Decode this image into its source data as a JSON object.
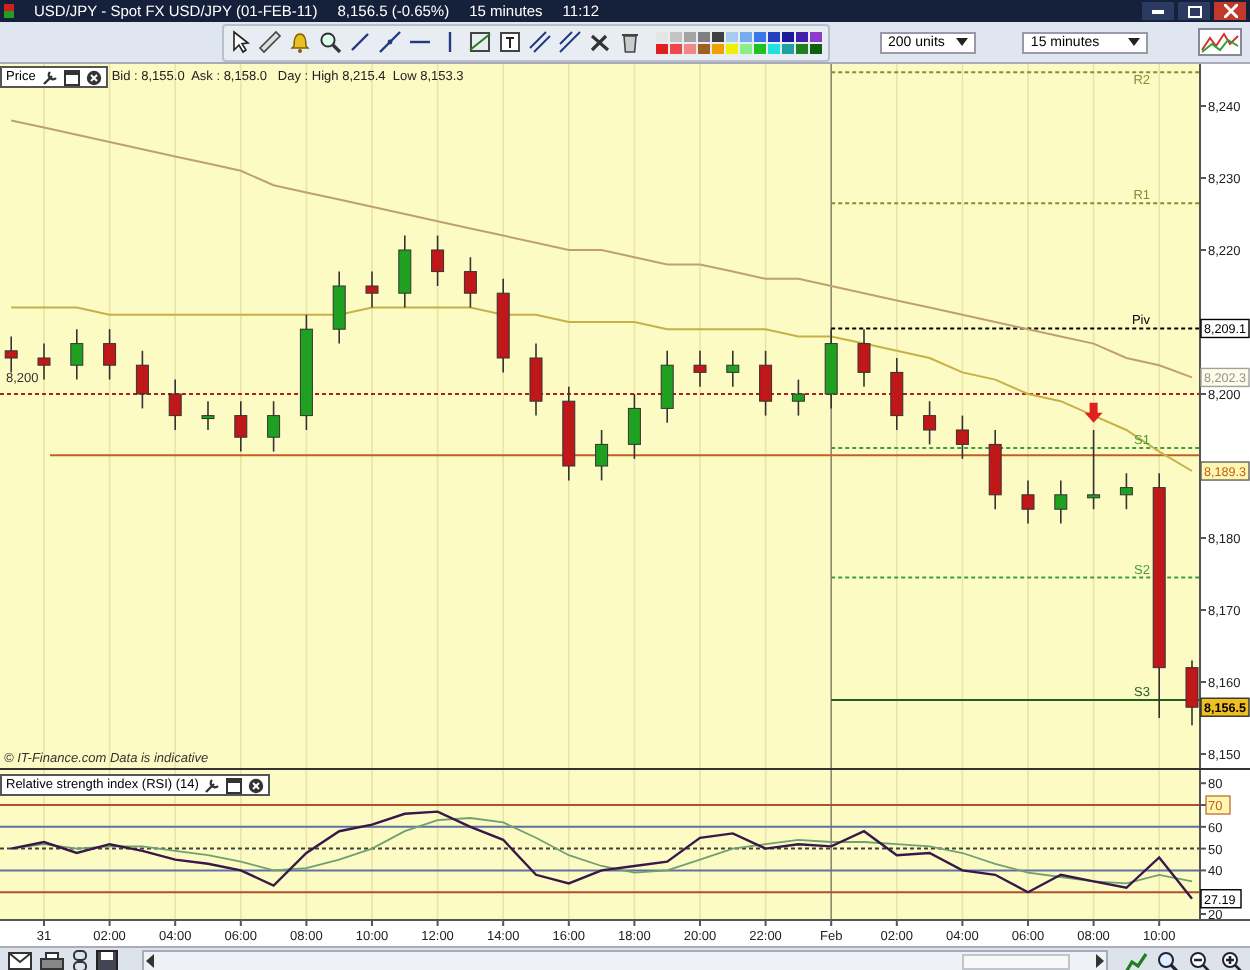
{
  "window": {
    "title": "USD/JPY - Spot FX USD/JPY (01-FEB-11)",
    "price": "8,156.5 (-0.65%)",
    "interval": "15 minutes",
    "time": "11:12"
  },
  "toolbar": {
    "palette": [
      {
        "color": "#e4e4e4"
      },
      {
        "color": "#c4c4c4"
      },
      {
        "color": "#a4a4a4"
      },
      {
        "color": "#808080"
      },
      {
        "color": "#404040"
      },
      {
        "color": "#a8ccf0"
      },
      {
        "color": "#78acf0"
      },
      {
        "color": "#3c78e8"
      },
      {
        "color": "#2040c0"
      },
      {
        "color": "#18189c"
      },
      {
        "color": "#4020a8"
      },
      {
        "color": "#8c3cc8"
      },
      {
        "color": "#e02020"
      },
      {
        "color": "#f04848"
      },
      {
        "color": "#f08888"
      },
      {
        "color": "#a06020"
      },
      {
        "color": "#f0a000"
      },
      {
        "color": "#f0f000"
      },
      {
        "color": "#88f088"
      },
      {
        "color": "#20c020"
      },
      {
        "color": "#20e0e0"
      },
      {
        "color": "#20a0a0"
      },
      {
        "color": "#208020"
      },
      {
        "color": "#106010"
      }
    ],
    "units_select": "200 units",
    "interval_select": "15 minutes"
  },
  "price_chart": {
    "label": "Price",
    "quote": "Bid : 8,155.0  Ask : 8,158.0   Day : High 8,215.4  Low 8,153.3",
    "footer": "© IT-Finance.com  Data is indicative",
    "chart_data": {
      "type": "candlestick",
      "grid": true,
      "ylim": [
        8148.06,
        8245.83
      ],
      "categories": [
        null,
        null,
        null,
        null,
        null,
        null,
        null,
        null,
        null,
        null,
        null,
        null,
        null,
        null,
        null,
        null,
        null,
        null,
        null,
        null,
        null,
        null,
        null,
        null,
        null,
        null,
        null,
        null,
        null,
        null,
        null,
        null,
        null,
        null,
        null,
        null,
        null
      ],
      "yticks": [
        {
          "value": 8240,
          "label": "8,240"
        },
        {
          "value": 8230,
          "label": "8,230"
        },
        {
          "value": 8220,
          "label": "8,220"
        },
        {
          "value": 8200,
          "label": "8,200"
        },
        {
          "value": 8180,
          "label": "8,180"
        },
        {
          "value": 8170,
          "label": "8,170"
        },
        {
          "value": 8160,
          "label": "8,160"
        },
        {
          "value": 8150,
          "label": "8,150"
        }
      ],
      "ohlc": [
        [
          8206,
          8208,
          8203,
          8205
        ],
        [
          8205,
          8207,
          8202,
          8204
        ],
        [
          8204,
          8209,
          8202,
          8207
        ],
        [
          8207,
          8209,
          8202,
          8204
        ],
        [
          8204,
          8206,
          8198,
          8200
        ],
        [
          8200,
          8202,
          8195,
          8197
        ],
        [
          8197,
          8199,
          8195,
          8197
        ],
        [
          8197,
          8199,
          8192,
          8194
        ],
        [
          8194,
          8199,
          8192,
          8197
        ],
        [
          8197,
          8211,
          8195,
          8209
        ],
        [
          8209,
          8217,
          8207,
          8215
        ],
        [
          8215,
          8217,
          8212,
          8214
        ],
        [
          8214,
          8222,
          8212,
          8220
        ],
        [
          8220,
          8222,
          8215,
          8217
        ],
        [
          8217,
          8219,
          8212,
          8214
        ],
        [
          8214,
          8216,
          8203,
          8205
        ],
        [
          8205,
          8207,
          8197,
          8199
        ],
        [
          8199,
          8201,
          8188,
          8190
        ],
        [
          8190,
          8195,
          8188,
          8193
        ],
        [
          8193,
          8200,
          8191,
          8198
        ],
        [
          8198,
          8206,
          8196,
          8204
        ],
        [
          8204,
          8206,
          8201,
          8203
        ],
        [
          8203,
          8206,
          8201,
          8204
        ],
        [
          8204,
          8206,
          8197,
          8199
        ],
        [
          8199,
          8202,
          8197,
          8200
        ],
        [
          8200,
          8209,
          8198,
          8207
        ],
        [
          8207,
          8209,
          8201,
          8203
        ],
        [
          8203,
          8205,
          8195,
          8197
        ],
        [
          8197,
          8199,
          8193,
          8195
        ],
        [
          8195,
          8197,
          8191,
          8193
        ],
        [
          8193,
          8195,
          8184,
          8186
        ],
        [
          8186,
          8188,
          8182,
          8184
        ],
        [
          8184,
          8188,
          8182,
          8186
        ],
        [
          8186,
          8195,
          8184,
          8186
        ],
        [
          8186,
          8189,
          8184,
          8187
        ],
        [
          8187,
          8189,
          8155,
          8162
        ],
        [
          8162,
          8163,
          8154,
          8156.5
        ]
      ],
      "series": [
        {
          "type": "line",
          "color": "#c0a070",
          "values": [
            8238,
            8237,
            8236,
            8235,
            8234,
            8233,
            8232,
            8231,
            8229,
            8228,
            8227,
            8226,
            8225,
            8224,
            8223,
            8222,
            8221,
            8220,
            8220,
            8219,
            8218,
            8218,
            8217,
            8216,
            8216,
            8215,
            8214,
            8213,
            8212,
            8211,
            8210,
            8209,
            8208,
            8207,
            8205,
            8204,
            8202.3
          ]
        },
        {
          "type": "line",
          "color": "#c8b048",
          "values": [
            8212,
            8212,
            8212,
            8211,
            8211,
            8211,
            8211,
            8211,
            8211,
            8211,
            8211,
            8212,
            8212,
            8212,
            8212,
            8211,
            8211,
            8210,
            8210,
            8210,
            8209,
            8209,
            8209,
            8209,
            8208,
            8208,
            8207,
            8206,
            8205,
            8203,
            8202,
            8200,
            8199,
            8197,
            8195,
            8192,
            8189.3
          ]
        }
      ],
      "ref_lines": [
        {
          "axis": "y",
          "value": 8244.7,
          "label": "R2"
        },
        {
          "axis": "y",
          "value": 8226.5,
          "label": "R1"
        },
        {
          "axis": "y",
          "value": 8209.1,
          "label": "Piv"
        },
        {
          "axis": "y",
          "value": 8200,
          "label": "8,200"
        },
        {
          "axis": "y",
          "value": 8191.5
        },
        {
          "axis": "y",
          "value": 8192.5,
          "label": "S1"
        },
        {
          "axis": "y",
          "value": 8174.5,
          "label": "S2"
        },
        {
          "axis": "y",
          "value": 8157.5,
          "label": "S3"
        }
      ],
      "annotations": [
        "8,209.1",
        "8,202.3",
        "8,189.3",
        "8,156.5"
      ]
    }
  },
  "rsi_panel": {
    "label": "Relative strength index (RSI) (14)",
    "chart_data": {
      "type": "line",
      "grid": true,
      "ylim": [
        17.25,
        86.06
      ],
      "categories": [
        null,
        "31",
        null,
        "02:00",
        null,
        "04:00",
        null,
        "06:00",
        null,
        "08:00",
        null,
        "10:00",
        null,
        "12:00",
        null,
        "14:00",
        null,
        "16:00",
        null,
        "18:00",
        null,
        "20:00",
        null,
        "22:00",
        null,
        "Feb",
        null,
        "02:00",
        null,
        "04:00",
        null,
        "06:00",
        null,
        "08:00",
        null,
        "10:00",
        null
      ],
      "yticks": [
        {
          "value": 80,
          "label": "80"
        },
        {
          "value": 70,
          "label": "70"
        },
        {
          "value": 60,
          "label": "60"
        },
        {
          "value": 50,
          "label": "50"
        },
        {
          "value": 40,
          "label": "40"
        },
        {
          "value": 20,
          "label": "20"
        }
      ],
      "series": [
        {
          "color": "#381848",
          "values": [
            50,
            53,
            48,
            52,
            49,
            45,
            43,
            40,
            33,
            48,
            58,
            61,
            66,
            67,
            60,
            54,
            38,
            34,
            40,
            42,
            44,
            55,
            57,
            50,
            52,
            51,
            58,
            47,
            48,
            40,
            38,
            30,
            38,
            35,
            32,
            46,
            27
          ]
        },
        {
          "color": "#70a070",
          "values": [
            50,
            52,
            50,
            51,
            51,
            49,
            47,
            44,
            40,
            41,
            45,
            50,
            58,
            63,
            64,
            62,
            55,
            47,
            42,
            39,
            40,
            45,
            50,
            52,
            54,
            53,
            53,
            52,
            51,
            48,
            43,
            39,
            37,
            35,
            34,
            38,
            35
          ]
        }
      ],
      "ref_lines": [
        {
          "axis": "y",
          "value": 70
        },
        {
          "axis": "y",
          "value": 60
        },
        {
          "axis": "y",
          "value": 50
        },
        {
          "axis": "y",
          "value": 40
        },
        {
          "axis": "y",
          "value": 30
        }
      ],
      "annotations": [
        "27.19"
      ]
    }
  }
}
